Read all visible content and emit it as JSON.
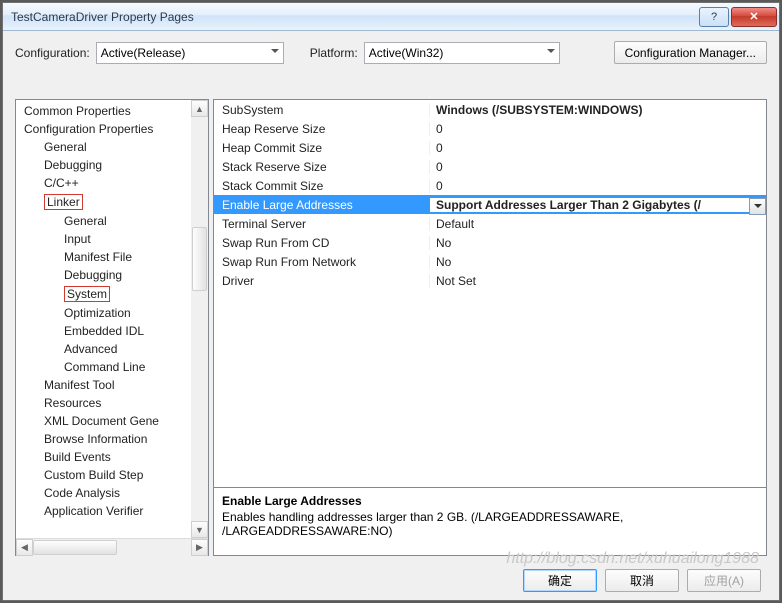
{
  "title": "TestCameraDriver Property Pages",
  "config": {
    "label": "Configuration:",
    "value": "Active(Release)"
  },
  "platform": {
    "label": "Platform:",
    "value": "Active(Win32)"
  },
  "cfg_mgr": "Configuration Manager...",
  "tree": {
    "n0": "Common Properties",
    "n1": "Configuration Properties",
    "c_general": "General",
    "c_debugging": "Debugging",
    "c_cc": "C/C++",
    "c_linker": "Linker",
    "l_general": "General",
    "l_input": "Input",
    "l_manifest": "Manifest File",
    "l_debug": "Debugging",
    "l_system": "System",
    "l_opt": "Optimization",
    "l_idl": "Embedded IDL",
    "l_adv": "Advanced",
    "l_cmd": "Command Line",
    "c_mftool": "Manifest Tool",
    "c_res": "Resources",
    "c_xml": "XML Document Gene",
    "c_browse": "Browse Information",
    "c_build": "Build Events",
    "c_custom": "Custom Build Step",
    "c_code": "Code Analysis",
    "c_appver": "Application Verifier"
  },
  "props": [
    {
      "name": "SubSystem",
      "value": "Windows (/SUBSYSTEM:WINDOWS)",
      "bold": true
    },
    {
      "name": "Heap Reserve Size",
      "value": "0"
    },
    {
      "name": "Heap Commit Size",
      "value": "0"
    },
    {
      "name": "Stack Reserve Size",
      "value": "0"
    },
    {
      "name": "Stack Commit Size",
      "value": "0"
    },
    {
      "name": "Enable Large Addresses",
      "value": "Support Addresses Larger Than 2 Gigabytes (/",
      "sel": true
    },
    {
      "name": "Terminal Server",
      "value": "Default"
    },
    {
      "name": "Swap Run From CD",
      "value": "No"
    },
    {
      "name": "Swap Run From Network",
      "value": "No"
    },
    {
      "name": "Driver",
      "value": "Not Set"
    }
  ],
  "desc": {
    "title": "Enable Large Addresses",
    "line1": "Enables handling addresses larger than 2 GB.     (/LARGEADDRESSAWARE,",
    "line2": "/LARGEADDRESSAWARE:NO)"
  },
  "buttons": {
    "ok": "确定",
    "cancel": "取消",
    "apply": "应用(A)"
  },
  "watermark": "http://blog.csdn.net/xuhuailong1988"
}
